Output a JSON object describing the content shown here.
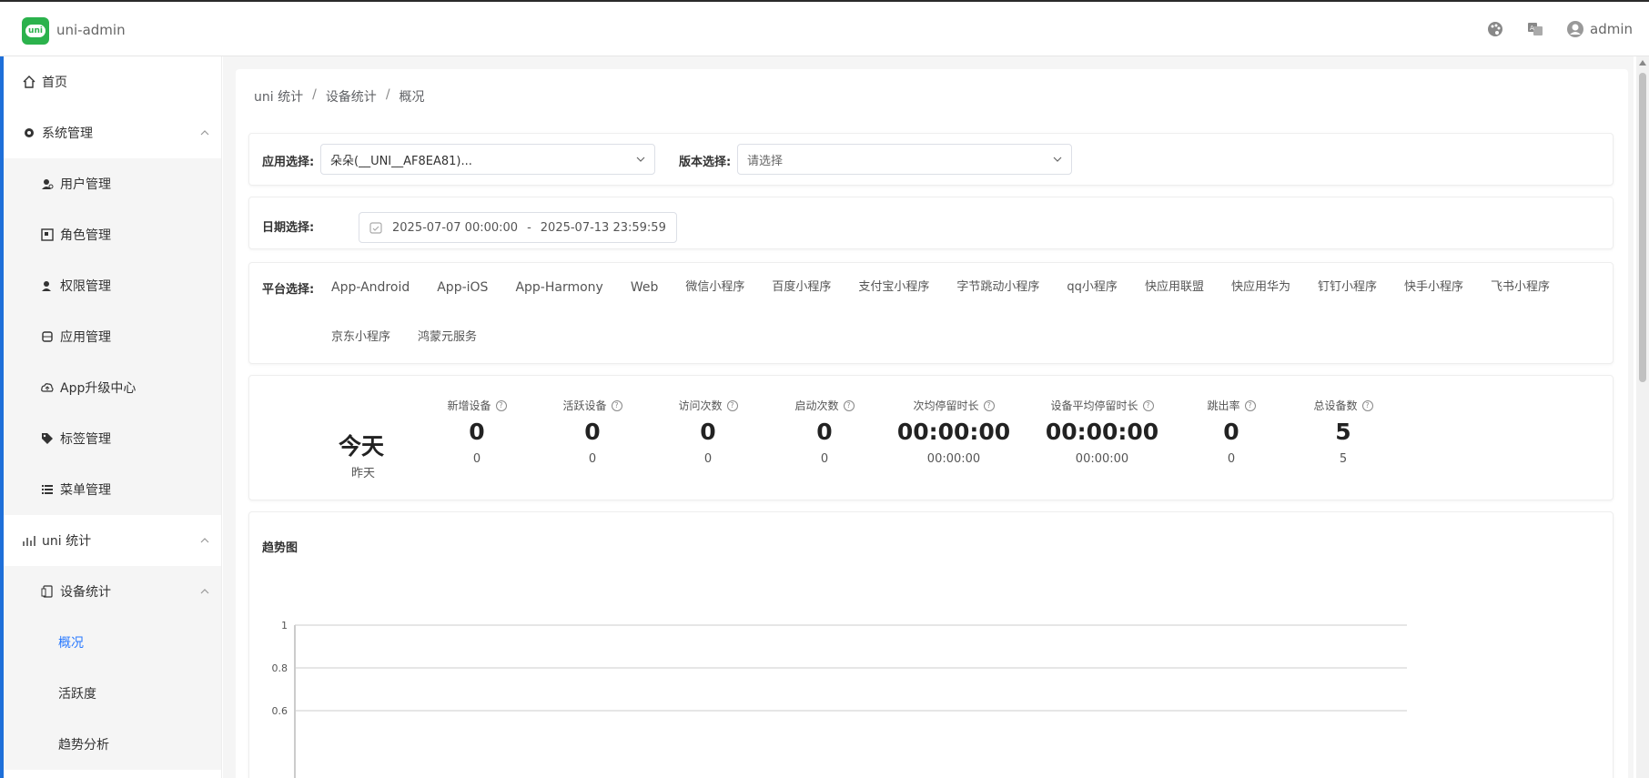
{
  "header": {
    "logo_text": "uni",
    "app_title": "uni-admin",
    "user": "admin",
    "icons": [
      "palette-icon",
      "translate-icon",
      "user-avatar-icon"
    ]
  },
  "sidebar": {
    "items": [
      {
        "label": "首页",
        "icon": "home-icon",
        "level": 0
      },
      {
        "label": "系统管理",
        "icon": "gear-icon",
        "level": 0,
        "expanded": true
      },
      {
        "label": "用户管理",
        "icon": "user-gear-icon",
        "level": 1
      },
      {
        "label": "角色管理",
        "icon": "role-icon",
        "level": 1
      },
      {
        "label": "权限管理",
        "icon": "permission-icon",
        "level": 1
      },
      {
        "label": "应用管理",
        "icon": "app-icon",
        "level": 1
      },
      {
        "label": "App升级中心",
        "icon": "cloud-upload-icon",
        "level": 1
      },
      {
        "label": "标签管理",
        "icon": "tag-icon",
        "level": 1
      },
      {
        "label": "菜单管理",
        "icon": "list-icon",
        "level": 1
      },
      {
        "label": "uni 统计",
        "icon": "chart-icon",
        "level": 0,
        "expanded": true
      },
      {
        "label": "设备统计",
        "icon": "device-icon",
        "level": 1,
        "expanded": true
      },
      {
        "label": "概况",
        "level": 2,
        "active": true
      },
      {
        "label": "活跃度",
        "level": 2
      },
      {
        "label": "趋势分析",
        "level": 2
      }
    ]
  },
  "breadcrumb": [
    "uni 统计",
    "设备统计",
    "概况"
  ],
  "filters": {
    "app_label": "应用选择:",
    "app_value": "朵朵(__UNI__AF8EA81)...",
    "version_label": "版本选择:",
    "version_placeholder": "请选择",
    "date_label": "日期选择:",
    "date_start": "2025-07-07 00:00:00",
    "date_sep": "-",
    "date_end": "2025-07-13 23:59:59",
    "platform_label": "平台选择:",
    "platforms": [
      "App-Android",
      "App-iOS",
      "App-Harmony",
      "Web",
      "微信小程序",
      "百度小程序",
      "支付宝小程序",
      "字节跳动小程序",
      "qq小程序",
      "快应用联盟",
      "快应用华为",
      "钉钉小程序",
      "快手小程序",
      "飞书小程序",
      "京东小程序",
      "鸿蒙元服务"
    ]
  },
  "stats": {
    "today_label": "今天",
    "yesterday_label": "昨天",
    "columns": [
      {
        "name": "新增设备",
        "today": "0",
        "yesterday": "0"
      },
      {
        "name": "活跃设备",
        "today": "0",
        "yesterday": "0"
      },
      {
        "name": "访问次数",
        "today": "0",
        "yesterday": "0"
      },
      {
        "name": "启动次数",
        "today": "0",
        "yesterday": "0"
      },
      {
        "name": "次均停留时长",
        "today": "00:00:00",
        "yesterday": "00:00:00"
      },
      {
        "name": "设备平均停留时长",
        "today": "00:00:00",
        "yesterday": "00:00:00"
      },
      {
        "name": "跳出率",
        "today": "0",
        "yesterday": "0"
      },
      {
        "name": "总设备数",
        "today": "5",
        "yesterday": "5"
      }
    ]
  },
  "trend": {
    "title": "趋势图"
  },
  "chart_data": {
    "type": "line",
    "title": "",
    "xlabel": "",
    "ylabel": "",
    "y_ticks": [
      "1",
      "0.8",
      "0.6"
    ],
    "ylim": [
      0,
      1
    ],
    "grid": true,
    "series": []
  },
  "colors": {
    "accent": "#2979ff",
    "logo": "#2bb24c"
  }
}
